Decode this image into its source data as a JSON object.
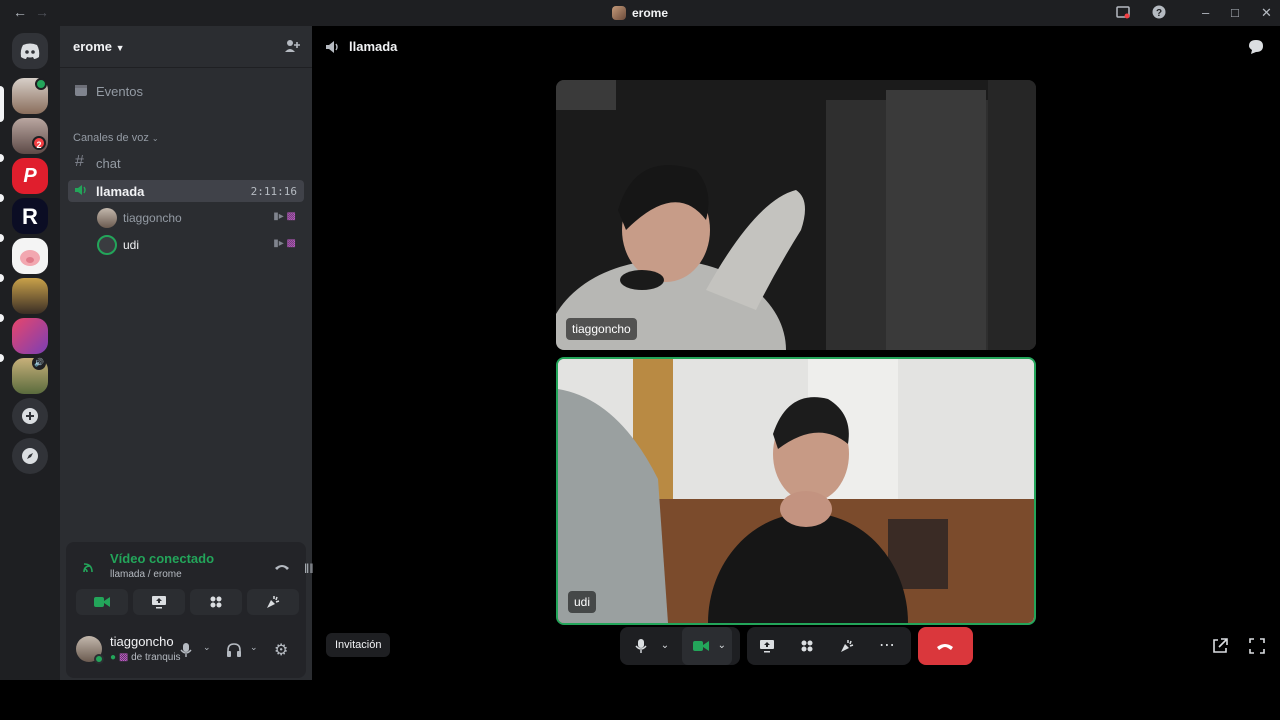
{
  "window": {
    "title": "erome",
    "back_icon": "arrow-left-icon",
    "forward_icon": "arrow-right-icon"
  },
  "server_rail": {
    "servers": [
      {
        "name": "discord-home",
        "badge": ""
      },
      {
        "name": "server-1",
        "badge": ""
      },
      {
        "name": "server-2",
        "badge": "2"
      },
      {
        "name": "server-podilo",
        "badge": ""
      },
      {
        "name": "server-r",
        "badge": ""
      },
      {
        "name": "server-pig",
        "badge": ""
      },
      {
        "name": "server-6",
        "badge": ""
      },
      {
        "name": "server-7",
        "badge": ""
      },
      {
        "name": "server-8",
        "badge": ""
      }
    ]
  },
  "sidebar": {
    "guild_name": "erome",
    "events_label": "Eventos",
    "voice_category": "Canales de voz",
    "text_channel": "chat",
    "voice_channel": "llamada",
    "voice_timer": "2:11:16",
    "voice_users": [
      {
        "name": "tiaggoncho",
        "color": "#949ba4"
      },
      {
        "name": "udi",
        "color": "#f2f3f5"
      }
    ]
  },
  "voice_panel": {
    "status": "Vídeo conectado",
    "location": "llamada / erome",
    "status_color": "#23a55a"
  },
  "user_panel": {
    "username": "tiaggoncho",
    "status_text": "de tranquis"
  },
  "main": {
    "channel_title": "llamada",
    "tiles": [
      {
        "name": "tiaggoncho",
        "speaking": false
      },
      {
        "name": "udi",
        "speaking": true
      }
    ],
    "invite_button": "Invitación",
    "hangup_color": "#da373c",
    "accent_green": "#23a55a"
  }
}
